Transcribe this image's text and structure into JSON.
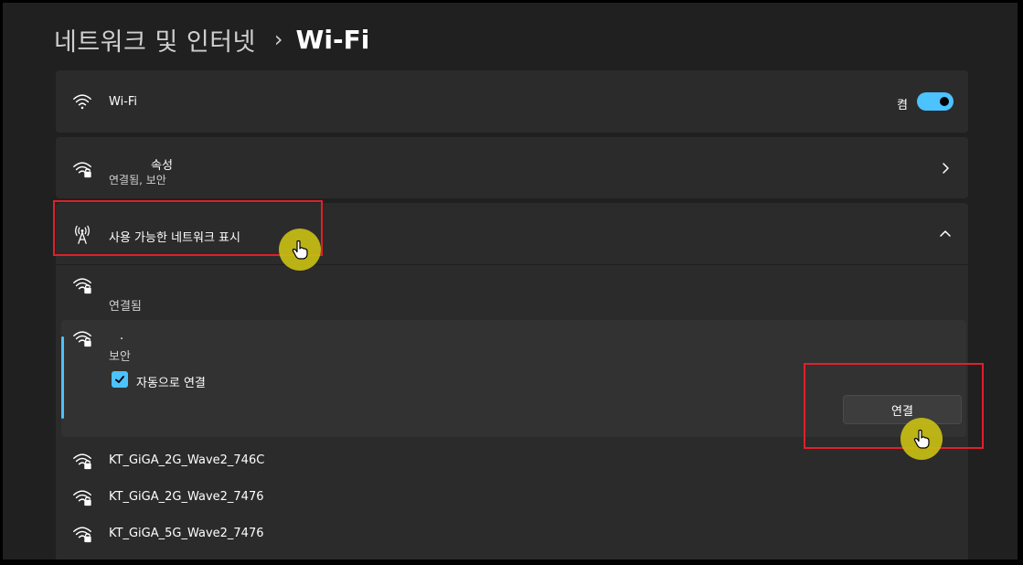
{
  "breadcrumb": {
    "parent": "네트워크 및 인터넷",
    "separator": "›",
    "current": "Wi-Fi"
  },
  "wifi_row": {
    "label": "Wi-Fi",
    "toggle_state_label": "켬",
    "toggle_on": true
  },
  "properties_row": {
    "title": "속성",
    "subtitle": "연결됨, 보안"
  },
  "available_networks": {
    "label": "사용 가능한 네트워크 표시",
    "expanded": true,
    "connected_network": {
      "status": "연결됨"
    },
    "selected_network": {
      "name": ".",
      "security": "보안",
      "auto_connect_label": "자동으로 연결",
      "auto_connect_checked": true,
      "connect_button": "연결"
    },
    "networks": [
      {
        "name": "KT_GiGA_2G_Wave2_746C"
      },
      {
        "name": "KT_GiGA_2G_Wave2_7476"
      },
      {
        "name": "KT_GiGA_5G_Wave2_7476"
      }
    ]
  },
  "colors": {
    "accent": "#4cc2ff",
    "highlight_box": "#e0202a",
    "cursor_halo": "#c8be14",
    "background": "#202020",
    "card": "#2b2b2b"
  },
  "icons": {
    "wifi": "wifi-icon",
    "wifi_secure": "wifi-lock-icon",
    "antenna": "antenna-icon",
    "chevron_right": "chevron-right-icon",
    "chevron_up": "chevron-up-icon",
    "check": "check-icon",
    "hand_cursor": "hand-cursor-icon"
  }
}
